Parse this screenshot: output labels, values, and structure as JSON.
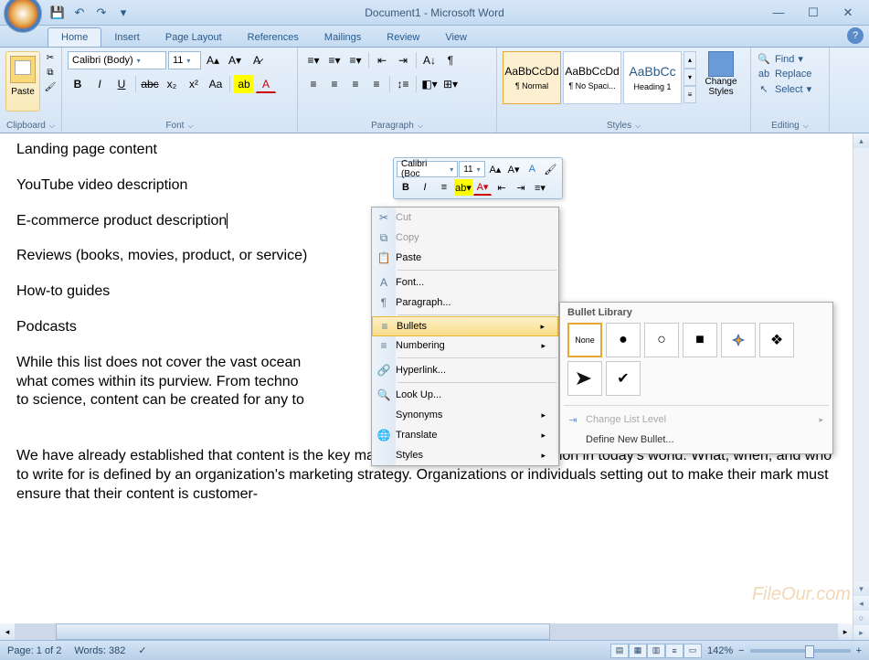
{
  "window": {
    "title": "Document1 - Microsoft Word"
  },
  "tabs": [
    "Home",
    "Insert",
    "Page Layout",
    "References",
    "Mailings",
    "Review",
    "View"
  ],
  "activeTab": "Home",
  "ribbon": {
    "clipboard": {
      "paste": "Paste",
      "label": "Clipboard"
    },
    "font": {
      "name": "Calibri (Body)",
      "size": "11",
      "label": "Font"
    },
    "paragraph": {
      "label": "Paragraph"
    },
    "styles": {
      "items": [
        {
          "preview": "AaBbCcDd",
          "name": "¶ Normal"
        },
        {
          "preview": "AaBbCcDd",
          "name": "¶ No Spaci..."
        },
        {
          "preview": "AaBbCc",
          "name": "Heading 1"
        }
      ],
      "change": "Change Styles",
      "label": "Styles"
    },
    "editing": {
      "find": "Find",
      "replace": "Replace",
      "select": "Select",
      "label": "Editing"
    }
  },
  "document": {
    "lines": [
      "Landing page content",
      "YouTube video description",
      "E-commerce product description",
      "Reviews (books, movies, product, or service)",
      "How-to guides",
      "Podcasts"
    ],
    "para1": "While this list does not cover the vast ocean",
    "para1b": "what comes within its purview. From techno",
    "para1c": "to science, content can be created for any to",
    "para2": "We have already established that content is the key marketing tool for any organization in today's world. What, when, and who to write for is defined by an organization's marketing strategy. Organizations or individuals setting out to make their mark must ensure that their content is customer-"
  },
  "miniToolbar": {
    "font": "Calibri (Boc",
    "size": "11"
  },
  "contextMenu": {
    "items": [
      {
        "icon": "✂",
        "label": "Cut",
        "disabled": true
      },
      {
        "icon": "⧉",
        "label": "Copy",
        "disabled": true
      },
      {
        "icon": "📋",
        "label": "Paste"
      },
      {
        "icon": "A",
        "label": "Font..."
      },
      {
        "icon": "¶",
        "label": "Paragraph..."
      },
      {
        "icon": "≡",
        "label": "Bullets",
        "submenu": true,
        "hover": true
      },
      {
        "icon": "≡",
        "label": "Numbering",
        "submenu": true
      },
      {
        "icon": "🔗",
        "label": "Hyperlink..."
      },
      {
        "icon": "🔍",
        "label": "Look Up..."
      },
      {
        "icon": "",
        "label": "Synonyms",
        "submenu": true
      },
      {
        "icon": "🌐",
        "label": "Translate",
        "submenu": true
      },
      {
        "icon": "",
        "label": "Styles",
        "submenu": true
      }
    ]
  },
  "bulletPanel": {
    "header": "Bullet Library",
    "cells": [
      "None",
      "●",
      "○",
      "■",
      "◆",
      "❖",
      "➤",
      "✔"
    ],
    "changeLevel": "Change List Level",
    "define": "Define New Bullet..."
  },
  "status": {
    "page": "Page: 1 of 2",
    "words": "Words: 382",
    "zoom": "142%"
  },
  "watermark": "FileOur.com"
}
